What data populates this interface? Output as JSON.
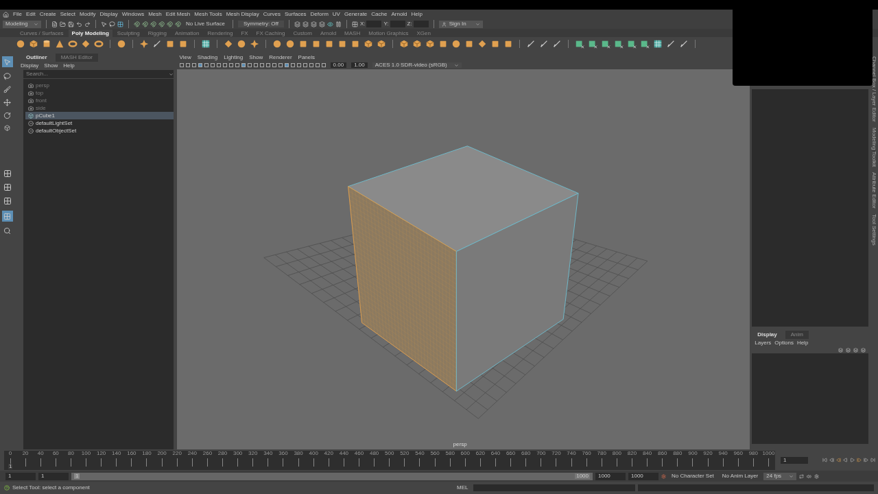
{
  "menu_bar": [
    "File",
    "Edit",
    "Create",
    "Select",
    "Modify",
    "Display",
    "Windows",
    "Mesh",
    "Edit Mesh",
    "Mesh Tools",
    "Mesh Display",
    "Curves",
    "Surfaces",
    "Deform",
    "UV",
    "Generate",
    "Cache",
    "Arnold",
    "Help"
  ],
  "toolbar": {
    "mode": "Modeling",
    "live_surface": "No Live Surface",
    "symmetry": "Symmetry: Off",
    "axis_labels": [
      "X:",
      "Y:",
      "Z:"
    ],
    "sign_in": "Sign In"
  },
  "shelf_tabs": [
    {
      "label": "Curves / Surfaces",
      "selected": false
    },
    {
      "label": "Poly Modeling",
      "selected": true
    },
    {
      "label": "Sculpting",
      "selected": false
    },
    {
      "label": "Rigging",
      "selected": false
    },
    {
      "label": "Animation",
      "selected": false
    },
    {
      "label": "Rendering",
      "selected": false
    },
    {
      "label": "FX",
      "selected": false
    },
    {
      "label": "FX Caching",
      "selected": false
    },
    {
      "label": "Custom",
      "selected": false
    },
    {
      "label": "Arnold",
      "selected": false
    },
    {
      "label": "MASH",
      "selected": false
    },
    {
      "label": "Motion Graphics",
      "selected": false
    },
    {
      "label": "XGen",
      "selected": false
    }
  ],
  "outliner": {
    "tabs": [
      {
        "label": "Outliner",
        "selected": true
      },
      {
        "label": "MASH Editor",
        "selected": false
      }
    ],
    "menu": [
      "Display",
      "Show",
      "Help"
    ],
    "search": {
      "placeholder": "Search..."
    },
    "items": [
      {
        "label": "persp",
        "kind": "camera",
        "dimmed": true,
        "selected": false
      },
      {
        "label": "top",
        "kind": "camera",
        "dimmed": true,
        "selected": false
      },
      {
        "label": "front",
        "kind": "camera",
        "dimmed": true,
        "selected": false
      },
      {
        "label": "side",
        "kind": "camera",
        "dimmed": true,
        "selected": false
      },
      {
        "label": "pCube1",
        "kind": "mesh",
        "dimmed": false,
        "selected": true
      },
      {
        "label": "defaultLightSet",
        "kind": "set",
        "dimmed": false,
        "selected": false
      },
      {
        "label": "defaultObjectSet",
        "kind": "set",
        "dimmed": false,
        "selected": false
      }
    ]
  },
  "viewport": {
    "menu": [
      "View",
      "Shading",
      "Lighting",
      "Show",
      "Renderer",
      "Panels"
    ],
    "exposure": "0.00",
    "gamma": "1.00",
    "color_space": "ACES 1.0 SDR-video (sRGB)",
    "camera_label": "persp"
  },
  "side_tabs": [
    "Channel Box / Layer Editor",
    "Modeling Toolkit",
    "Attribute Editor",
    "Tool Settings"
  ],
  "layer_editor": {
    "tabs": [
      {
        "label": "Display",
        "selected": true
      },
      {
        "label": "Anim",
        "selected": false
      }
    ],
    "menu": [
      "Layers",
      "Options",
      "Help"
    ]
  },
  "timeline": {
    "ticks": [
      "0",
      "20",
      "40",
      "60",
      "80",
      "100",
      "120",
      "140",
      "160",
      "180",
      "200",
      "220",
      "240",
      "260",
      "280",
      "300",
      "320",
      "340",
      "360",
      "380",
      "400",
      "420",
      "440",
      "460",
      "480",
      "500",
      "520",
      "540",
      "560",
      "580",
      "600",
      "620",
      "640",
      "660",
      "680",
      "700",
      "720",
      "740",
      "760",
      "780",
      "800",
      "820",
      "840",
      "860",
      "880",
      "900",
      "920",
      "940",
      "960",
      "980",
      "1000"
    ],
    "current_frame": "1",
    "level": 0,
    "frame_field": "1"
  },
  "range": {
    "start": "1",
    "playback_start": "1",
    "slider_start": "1",
    "slider_end": "1000",
    "level": 1,
    "playback_end": "1000",
    "end": "1000",
    "character_set": "No Character Set",
    "anim_layer": "No Anim Layer",
    "fps": "24 fps"
  },
  "status": {
    "help": "Select Tool: select a component",
    "command_label": "MEL"
  }
}
